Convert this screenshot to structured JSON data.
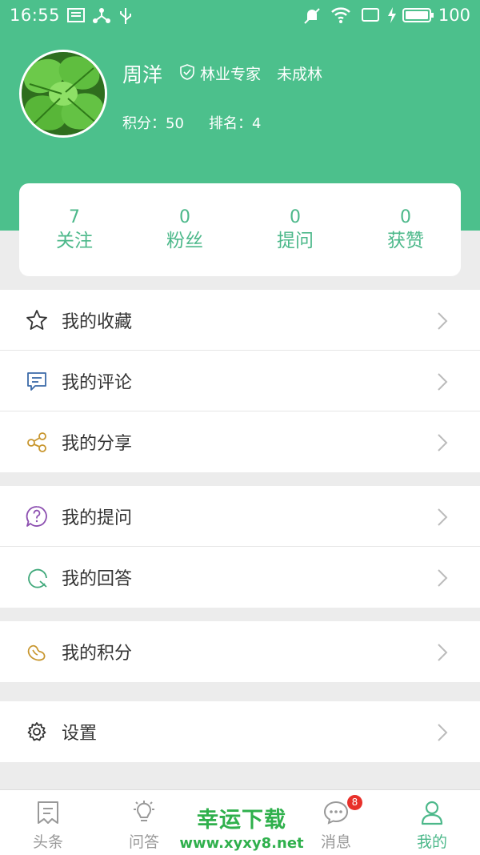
{
  "status_bar": {
    "time": "16:55",
    "battery_percent": "100"
  },
  "profile": {
    "name": "周洋",
    "role": "林业专家",
    "rank_title": "未成林",
    "points_label": "积分：50",
    "ranking_label": "排名：4"
  },
  "stats": [
    {
      "value": "7",
      "label": "关注"
    },
    {
      "value": "0",
      "label": "粉丝"
    },
    {
      "value": "0",
      "label": "提问"
    },
    {
      "value": "0",
      "label": "获赞"
    }
  ],
  "menu": {
    "favorites": "我的收藏",
    "comments": "我的评论",
    "shares": "我的分享",
    "questions": "我的提问",
    "answers": "我的回答",
    "points": "我的积分",
    "settings": "设置"
  },
  "tabs": {
    "headlines": "头条",
    "qa": "问答",
    "messages": "消息",
    "messages_badge": "8",
    "mine": "我的"
  },
  "watermark": {
    "line1": "幸运下载",
    "line2": "www.xyxy8.net"
  },
  "colors": {
    "primary": "#4cc08c",
    "accent_text": "#4cb88a",
    "badge": "#e8302a"
  }
}
